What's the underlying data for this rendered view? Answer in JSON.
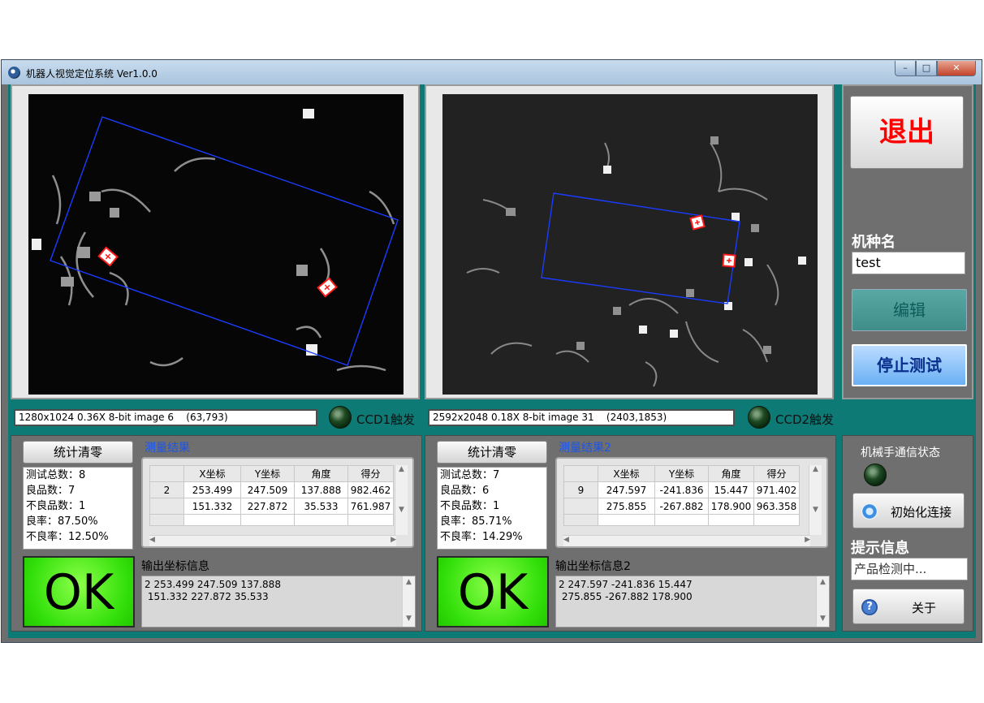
{
  "window": {
    "title": "机器人视觉定位系统  Ver1.0.0",
    "minimize_glyph": "–",
    "maximize_glyph": "□",
    "close_glyph": "✕"
  },
  "ccd1": {
    "status_text": "1280x1024 0.36X 8-bit image 6    (63,793)",
    "trigger_label": "CCD1触发",
    "clear_button": "统计清零",
    "stats": [
      "测试总数：8",
      "良品数：7",
      "不良品数：1",
      "良率：87.50%",
      "不良率：12.50%"
    ],
    "results_title": "测量结果",
    "table_headers": [
      "",
      "X坐标",
      "Y坐标",
      "角度",
      "得分"
    ],
    "table_rows": [
      [
        "2",
        "253.499",
        "247.509",
        "137.888",
        "982.462"
      ],
      [
        "",
        "151.332",
        "227.872",
        "35.533",
        "761.987"
      ],
      [
        "",
        "",
        "",
        "",
        ""
      ]
    ],
    "result": "OK",
    "output_title": "输出坐标信息",
    "output_lines": [
      "2 253.499 247.509 137.888",
      " 151.332 227.872 35.533"
    ]
  },
  "ccd2": {
    "status_text": "2592x2048 0.18X 8-bit image 31    (2403,1853)",
    "trigger_label": "CCD2触发",
    "clear_button": "统计清零",
    "stats": [
      "测试总数：7",
      "良品数：6",
      "不良品数：1",
      "良率：85.71%",
      "不良率：14.29%"
    ],
    "results_title": "测量结果2",
    "table_headers": [
      "",
      "X坐标",
      "Y坐标",
      "角度",
      "得分"
    ],
    "table_rows": [
      [
        "9",
        "247.597",
        "-241.836",
        "15.447",
        "971.402"
      ],
      [
        "",
        "275.855",
        "-267.882",
        "178.900",
        "963.358"
      ],
      [
        "",
        "",
        "",
        "",
        ""
      ]
    ],
    "result": "OK",
    "output_title": "输出坐标信息2",
    "output_lines": [
      "2 247.597 -241.836 15.447",
      " 275.855 -267.882 178.900"
    ]
  },
  "side": {
    "exit_button": "退出",
    "model_label": "机种名",
    "model_value": "test",
    "edit_button": "编辑",
    "stop_test_button": "停止测试",
    "comm_status_label": "机械手通信状态",
    "init_button": "初始化连接",
    "hint_label": "提示信息",
    "hint_value": "产品检测中...",
    "about_button": "关于"
  },
  "colors": {
    "panel_teal": "#0e7a76",
    "ok_green": "#33e00a",
    "exit_red": "#ff0000",
    "roi_blue": "#1a3cff",
    "match_red": "#ff1a1a"
  },
  "icons": {
    "refresh": "refresh-icon",
    "help": "help-icon"
  }
}
